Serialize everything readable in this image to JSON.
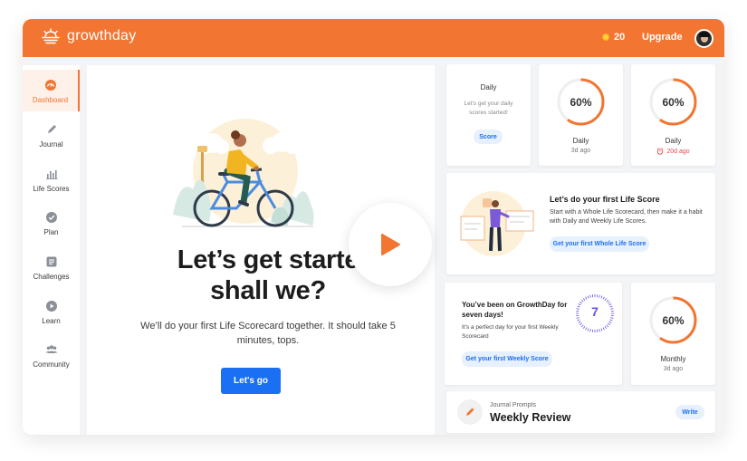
{
  "brand": {
    "name": "growthday"
  },
  "header": {
    "coins": "20",
    "upgrade_label": "Upgrade"
  },
  "sidebar": {
    "items": [
      {
        "label": "Dashboard",
        "icon": "dashboard-icon",
        "active": true
      },
      {
        "label": "Journal",
        "icon": "pen-icon"
      },
      {
        "label": "Life Scores",
        "icon": "bar-chart-icon"
      },
      {
        "label": "Plan",
        "icon": "check-circle-icon"
      },
      {
        "label": "Challenges",
        "icon": "list-icon"
      },
      {
        "label": "Learn",
        "icon": "play-circle-icon"
      },
      {
        "label": "Community",
        "icon": "people-icon"
      }
    ]
  },
  "hero": {
    "title_line1": "Let’s get starte",
    "title_line2": "shall we?",
    "subtitle": "We’ll do your first Life Scorecard together. It should take 5 minutes, tops.",
    "cta": "Let's go"
  },
  "cards": {
    "daily_start": {
      "title": "Daily",
      "text": "Let's get your daily scores started!",
      "button": "Score"
    },
    "daily_score_1": {
      "percent": "60%",
      "value": 0.6,
      "label": "Daily",
      "sub": "3d ago"
    },
    "daily_score_2": {
      "percent": "60%",
      "value": 0.6,
      "label": "Daily",
      "sub": "20d ago"
    },
    "first_life_score": {
      "title": "Let’s do your first Life Score",
      "text": "Start with a Whole Life Scorecard, then make it a habit with Daily and Weekly Life Scores.",
      "button": "Get your first Whole Life Score"
    },
    "seven_days": {
      "title": "You’ve been on GrowthDay for seven days!",
      "text": "It's a perfect day for your first Weekly Scorecard",
      "button": "Get your first Weekly Score",
      "count": "7"
    },
    "monthly_score": {
      "percent": "60%",
      "value": 0.6,
      "label": "Monthly",
      "sub": "3d ago"
    },
    "journal": {
      "kicker": "Journal Prompts",
      "title": "Weekly Review",
      "button": "Write"
    }
  },
  "colors": {
    "brand": "#f27531",
    "accent_blue": "#1b6ff2",
    "ring_purple": "#6c4ee0",
    "alert_red": "#e5484d"
  }
}
